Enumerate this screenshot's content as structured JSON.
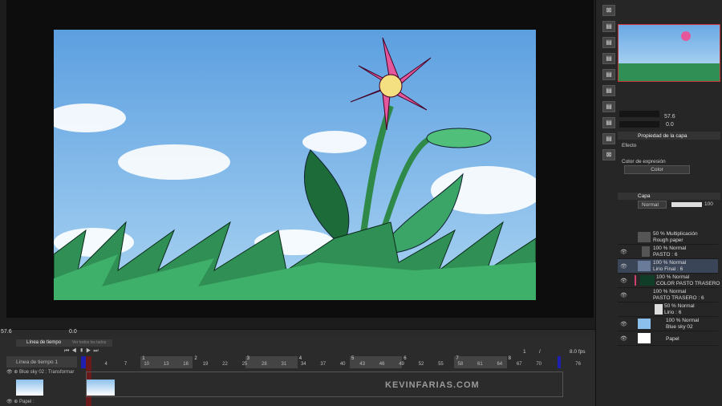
{
  "canvas": {
    "zoom": "57.6",
    "rotation": "0.0",
    "watermark": "KEVINFARIAS.COM"
  },
  "navigator": {
    "zoom": "57.6",
    "rotation": "0.0"
  },
  "layer_property": {
    "title": "Propiedad de la capa",
    "effect_label": "Efecto",
    "expression_label": "Color de expresión",
    "expression_value": "Color"
  },
  "layers_panel": {
    "title": "Capa",
    "blend_mode": "Normal",
    "opacity": "100",
    "layers": [
      {
        "mode": "50 % Multiplicación",
        "name": "Rough paper"
      },
      {
        "mode": "100 % Normal",
        "name": "PASTO : 6"
      },
      {
        "mode": "100 % Normal",
        "name": "Lirio Final : 6"
      },
      {
        "mode": "100 % Normal",
        "name": "COLOR PASTO TRASERO"
      },
      {
        "mode": "100 % Normal",
        "name": "PASTO TRASERO : 6"
      },
      {
        "mode": "50 % Normal",
        "name": "Lirio : 6"
      },
      {
        "mode": "100 % Normal",
        "name": "Blue sky 02"
      },
      {
        "mode": "",
        "name": "Papel"
      }
    ]
  },
  "timeline": {
    "tab": "Línea de tiempo",
    "tab2": "Ver todos los lados",
    "name": "Línea de tiempo 1",
    "current_frame": "1",
    "separator": "/",
    "fps": "8.0 fps",
    "tracks": [
      {
        "name": "Blue sky 02 : Transformar"
      },
      {
        "name": "Papel :"
      }
    ],
    "seconds": [
      "1",
      "2",
      "3",
      "4",
      "5",
      "6",
      "7",
      "8"
    ],
    "frames": [
      "4",
      "7",
      "10",
      "13",
      "16",
      "19",
      "22",
      "25",
      "28",
      "31",
      "34",
      "37",
      "40",
      "43",
      "46",
      "49",
      "52",
      "55",
      "58",
      "61",
      "64",
      "67",
      "70",
      "76"
    ]
  }
}
